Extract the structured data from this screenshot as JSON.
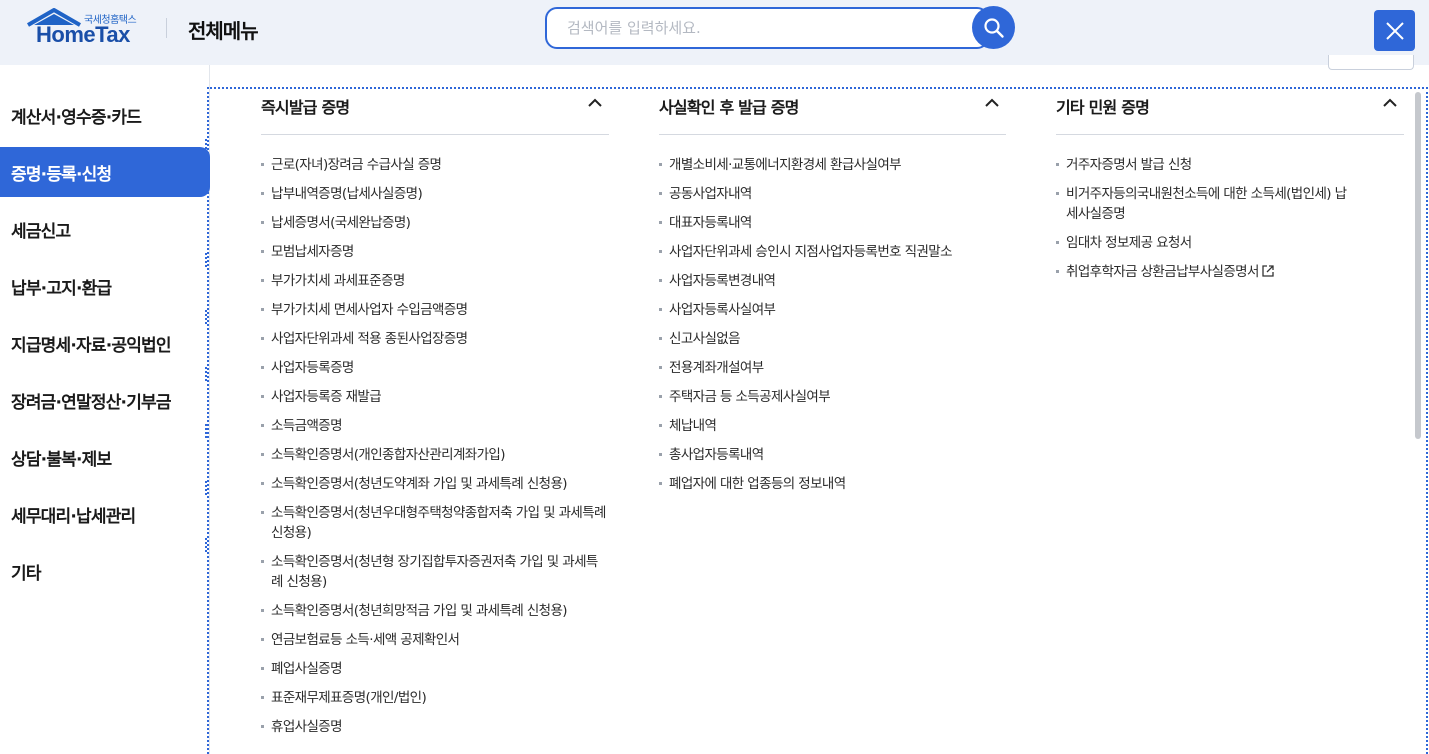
{
  "header": {
    "logo_sub": "국세청홈택스",
    "logo_main": "HomeTax",
    "menu_title": "전체메뉴",
    "search_placeholder": "검색어를 입력하세요.",
    "search_icon": "search-icon",
    "close_icon": "close-icon"
  },
  "sidebar": {
    "items": [
      {
        "label": "계산서·영수증·카드"
      },
      {
        "label": "증명·등록·신청",
        "active": true
      },
      {
        "label": "세금신고"
      },
      {
        "label": "납부·고지·환급"
      },
      {
        "label": "지급명세·자료·공익법인"
      },
      {
        "label": "장려금·연말정산·기부금"
      },
      {
        "label": "상담·불복·제보"
      },
      {
        "label": "세무대리·납세관리"
      },
      {
        "label": "기타"
      }
    ]
  },
  "columns": [
    {
      "title": "즉시발급 증명",
      "toggle_icon": "chevron-up-icon",
      "items": [
        "근로(자녀)장려금 수급사실 증명",
        "납부내역증명(납세사실증명)",
        "납세증명서(국세완납증명)",
        "모범납세자증명",
        "부가가치세 과세표준증명",
        "부가가치세 면세사업자 수입금액증명",
        "사업자단위과세 적용 종된사업장증명",
        "사업자등록증명",
        "사업자등록증 재발급",
        "소득금액증명",
        "소득확인증명서(개인종합자산관리계좌가입)",
        "소득확인증명서(청년도약계좌 가입 및 과세특례 신청용)",
        "소득확인증명서(청년우대형주택청약종합저축 가입 및 과세특례 신청용)",
        "소득확인증명서(청년형 장기집합투자증권저축 가입 및 과세특례 신청용)",
        "소득확인증명서(청년희망적금 가입 및 과세특례 신청용)",
        "연금보험료등 소득·세액 공제확인서",
        "폐업사실증명",
        "표준재무제표증명(개인/법인)",
        "휴업사실증명"
      ]
    },
    {
      "title": "사실확인 후 발급 증명",
      "toggle_icon": "chevron-up-icon",
      "items": [
        "개별소비세·교통에너지환경세 환급사실여부",
        "공동사업자내역",
        "대표자등록내역",
        "사업자단위과세 승인시 지점사업자등록번호 직권말소",
        "사업자등록변경내역",
        "사업자등록사실여부",
        "신고사실없음",
        "전용계좌개설여부",
        "주택자금 등 소득공제사실여부",
        "체납내역",
        "총사업자등록내역",
        "폐업자에 대한 업종등의 정보내역"
      ]
    },
    {
      "title": "기타 민원 증명",
      "toggle_icon": "chevron-up-icon",
      "items": [
        "거주자증명서 발급 신청",
        "비거주자등의국내원천소득에 대한 소득세(법인세) 납세사실증명",
        "임대차 정보제공 요청서",
        "취업후학자금 상환금납부사실증명서"
      ],
      "external_link_icon": "external-link-icon"
    }
  ],
  "colors": {
    "accent": "#2f67d8",
    "header_bg": "#eef2f9"
  }
}
